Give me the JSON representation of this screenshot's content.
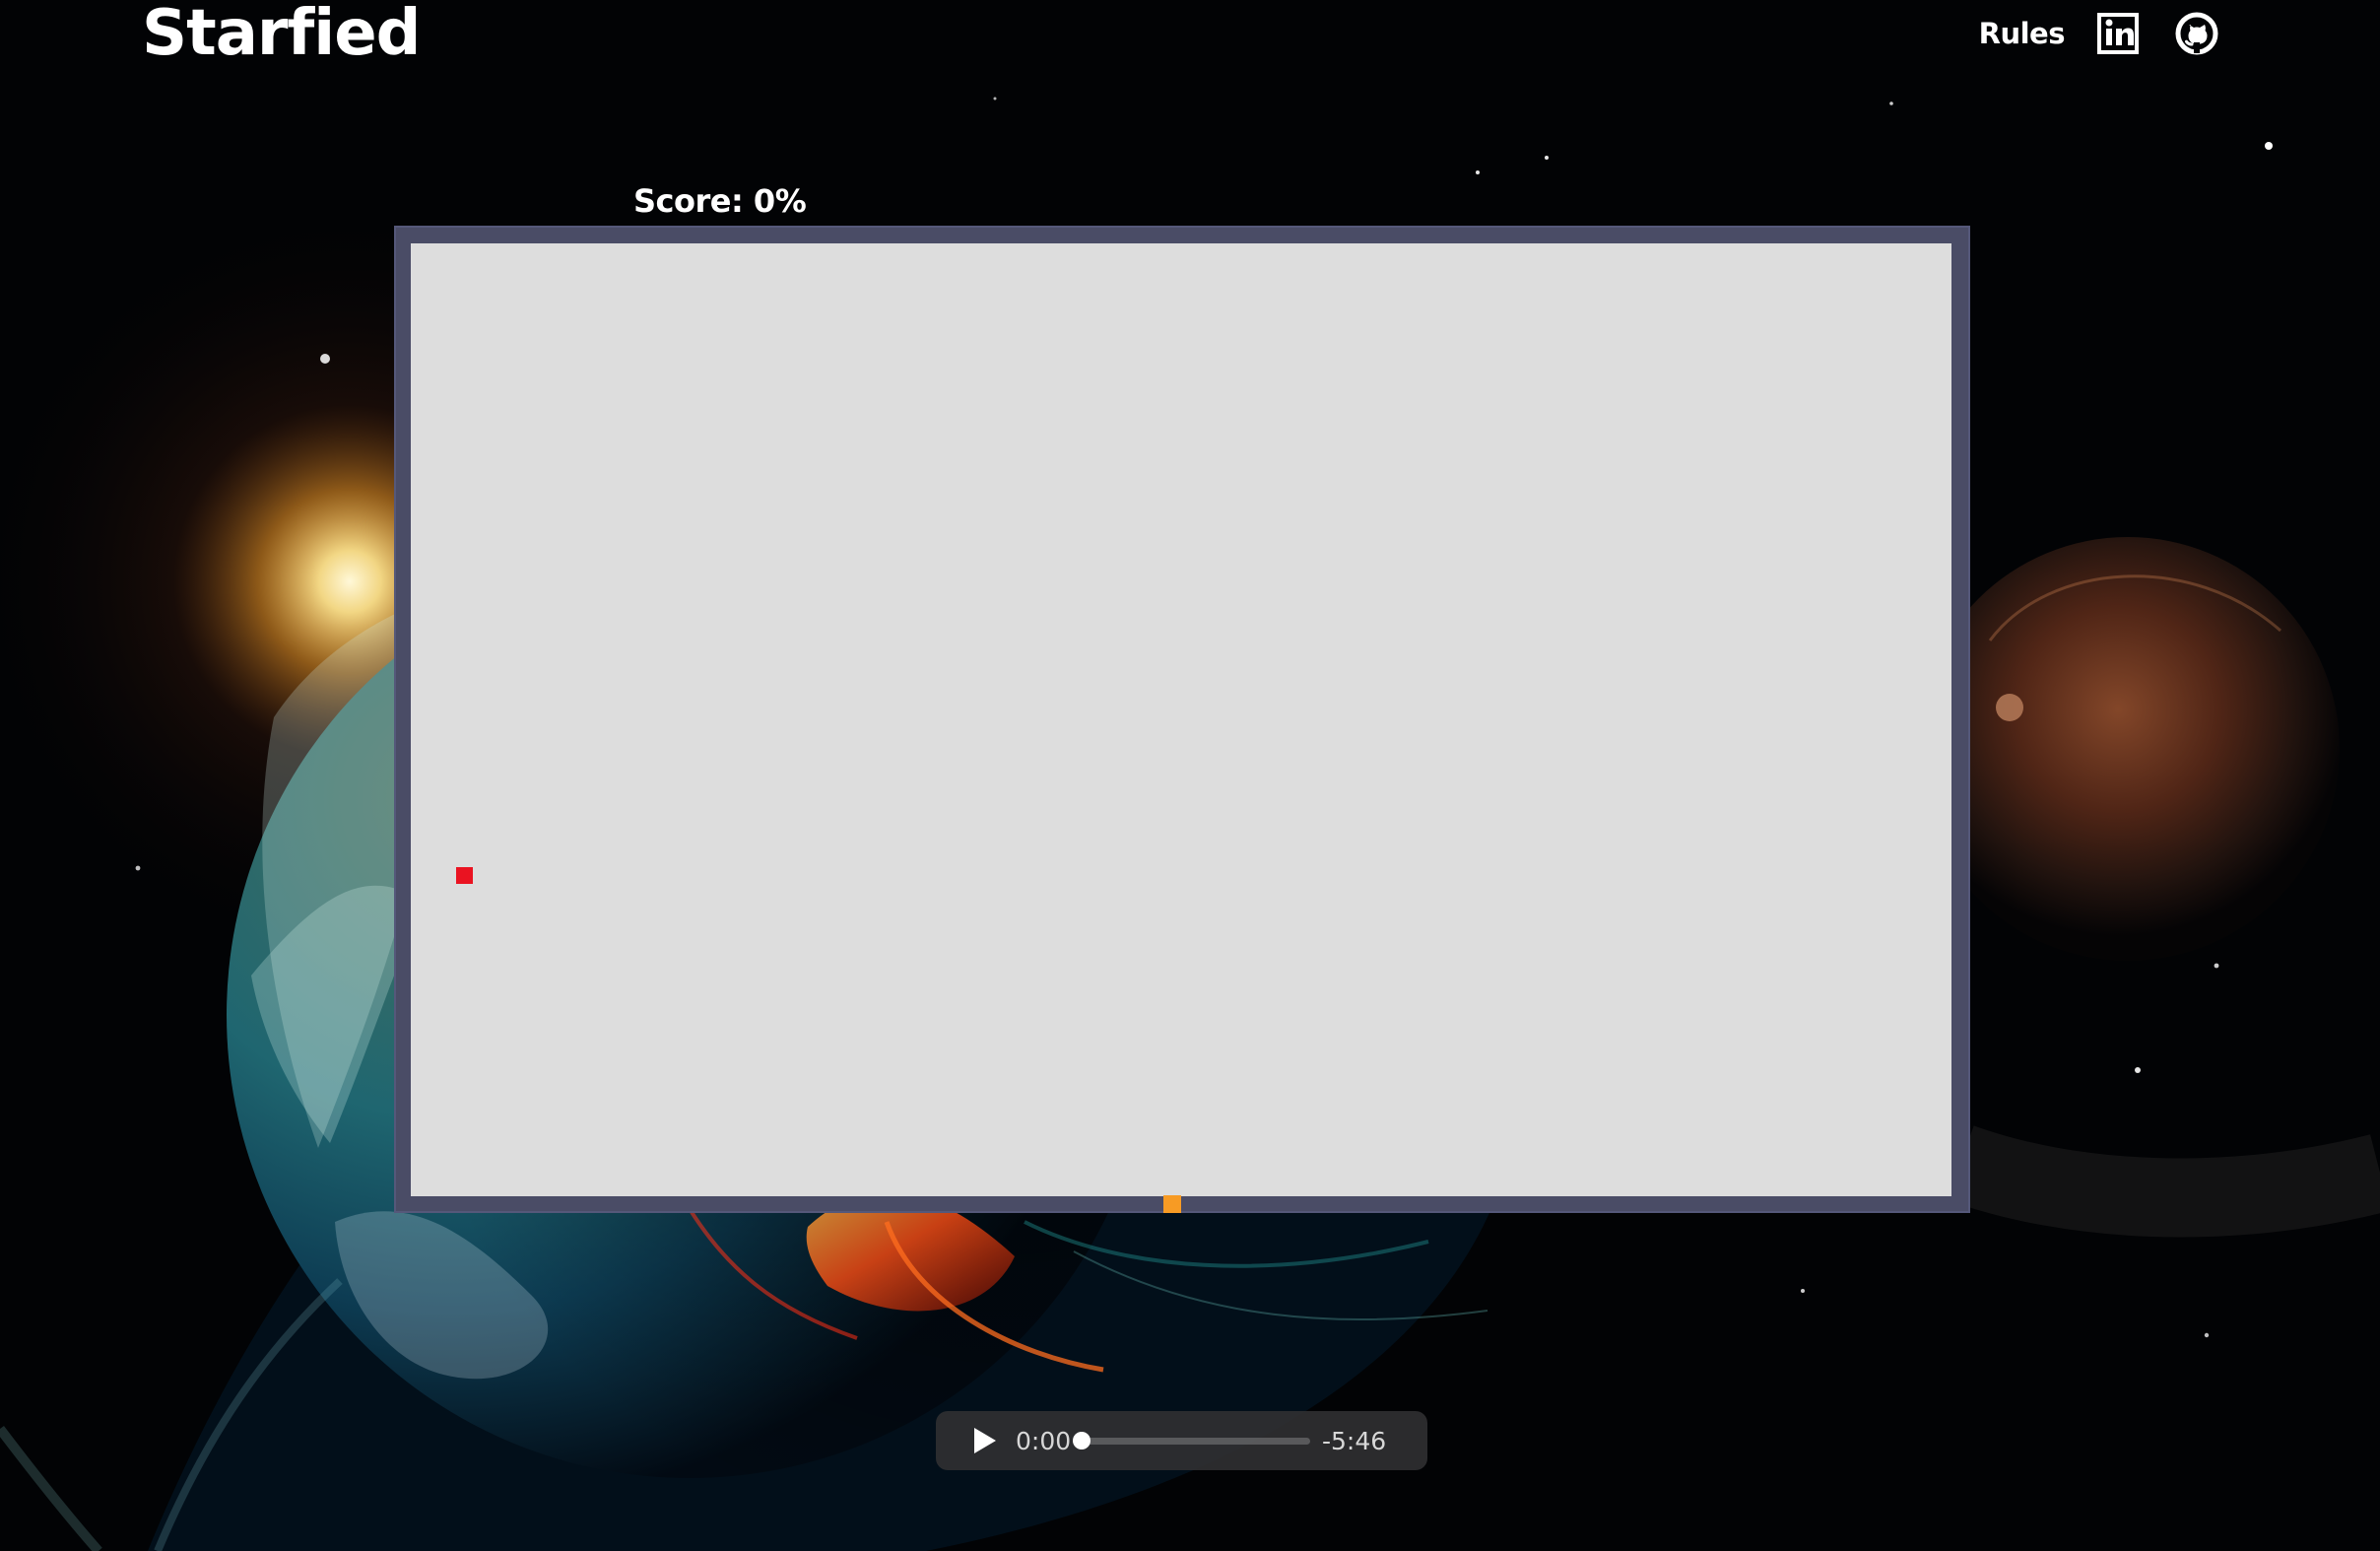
{
  "header": {
    "title": "Starfied",
    "nav": {
      "rules_label": "Rules",
      "linkedin_icon": "linkedin-icon",
      "github_icon": "github-icon"
    }
  },
  "game": {
    "score_label": "Score: 0%",
    "playfield_color": "#dddddd",
    "frame_color": "#4a4c66",
    "player_color": "#ea1321",
    "spark_color": "#f79b24"
  },
  "audio": {
    "current_time": "0:00",
    "remaining_time": "-5:46",
    "progress": 0,
    "play_icon": "play-icon"
  },
  "background": {
    "description_icon": "space-planets-background"
  }
}
